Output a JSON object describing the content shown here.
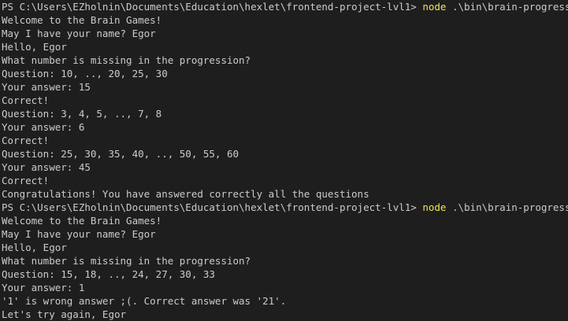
{
  "terminal": {
    "colors": {
      "background": "#1e1e1e",
      "text": "#cccccc",
      "command": "#f0e35b"
    },
    "lines": [
      {
        "prompt": "PS C:\\Users\\EZholnin\\Documents\\Education\\hexlet\\frontend-project-lvl1> ",
        "cmd": "node",
        "args": " .\\bin\\brain-progression.js"
      },
      {
        "text": "Welcome to the Brain Games!"
      },
      {
        "text": "May I have your name? Egor"
      },
      {
        "text": "Hello, Egor"
      },
      {
        "text": "What number is missing in the progression?"
      },
      {
        "text": "Question: 10, .., 20, 25, 30"
      },
      {
        "text": "Your answer: 15"
      },
      {
        "text": "Correct!"
      },
      {
        "text": "Question: 3, 4, 5, .., 7, 8"
      },
      {
        "text": "Your answer: 6"
      },
      {
        "text": "Correct!"
      },
      {
        "text": "Question: 25, 30, 35, 40, .., 50, 55, 60"
      },
      {
        "text": "Your answer: 45"
      },
      {
        "text": "Correct!"
      },
      {
        "text": "Congratulations! You have answered correctly all the questions"
      },
      {
        "prompt": "PS C:\\Users\\EZholnin\\Documents\\Education\\hexlet\\frontend-project-lvl1> ",
        "cmd": "node",
        "args": " .\\bin\\brain-progression.js"
      },
      {
        "text": "Welcome to the Brain Games!"
      },
      {
        "text": "May I have your name? Egor"
      },
      {
        "text": "Hello, Egor"
      },
      {
        "text": "What number is missing in the progression?"
      },
      {
        "text": "Question: 15, 18, .., 24, 27, 30, 33"
      },
      {
        "text": "Your answer: 1"
      },
      {
        "text": "'1' is wrong answer ;(. Correct answer was '21'."
      },
      {
        "text": "Let's try again, Egor"
      }
    ]
  }
}
